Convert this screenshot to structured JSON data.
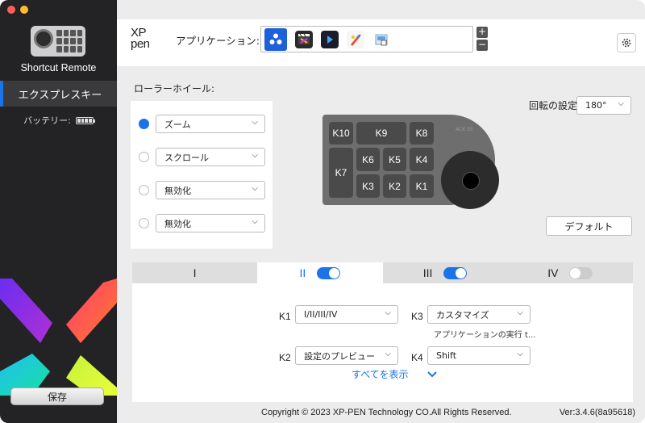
{
  "sidebar": {
    "device_name": "Shortcut Remote",
    "active_item": "エクスプレスキー",
    "battery_label": "バッテリー:",
    "save_label": "保存"
  },
  "header": {
    "logo_line1": "XP",
    "logo_line2": "pen",
    "app_label": "アプリケーション:",
    "apps": [
      "all-apps-icon",
      "final-cut-pro-icon",
      "davinci-resolve-icon",
      "painter-icon",
      "preview-icon"
    ],
    "plus": "+",
    "minus": "−"
  },
  "wheel": {
    "label": "ローラーホイール:",
    "options": [
      {
        "value": "ズーム",
        "selected": true
      },
      {
        "value": "スクロール",
        "selected": false
      },
      {
        "value": "無効化",
        "selected": false
      },
      {
        "value": "無効化",
        "selected": false
      }
    ]
  },
  "rotation": {
    "label": "回転の設定",
    "value": "180°"
  },
  "device": {
    "keys": [
      "K10",
      "K9",
      "K8",
      "K7",
      "K6",
      "K5",
      "K4",
      "K3",
      "K2",
      "K1"
    ],
    "brand": "ACK 05"
  },
  "default_label": "デフォルト",
  "tabs": [
    {
      "label": "I",
      "toggle": null,
      "active": false
    },
    {
      "label": "II",
      "toggle": "on",
      "active": true
    },
    {
      "label": "III",
      "toggle": "on",
      "active": false
    },
    {
      "label": "IV",
      "toggle": "off",
      "active": false
    }
  ],
  "keys_panel": {
    "k1": {
      "label": "K1",
      "value": "I/II/III/IV"
    },
    "k2": {
      "label": "K2",
      "value": "設定のプレビュー"
    },
    "k3": {
      "label": "K3",
      "value": "カスタマイズ",
      "note": "アプリケーションの実行 t..."
    },
    "k4": {
      "label": "K4",
      "value": "Shift"
    },
    "show_all": "すべてを表示"
  },
  "footer": {
    "copyright": "Copyright © 2023  XP-PEN Technology CO.All Rights Reserved.",
    "version": "Ver:3.4.6(8a95618)"
  },
  "colors": {
    "accent": "#1a73e8",
    "sidebar_bg": "#232325"
  }
}
